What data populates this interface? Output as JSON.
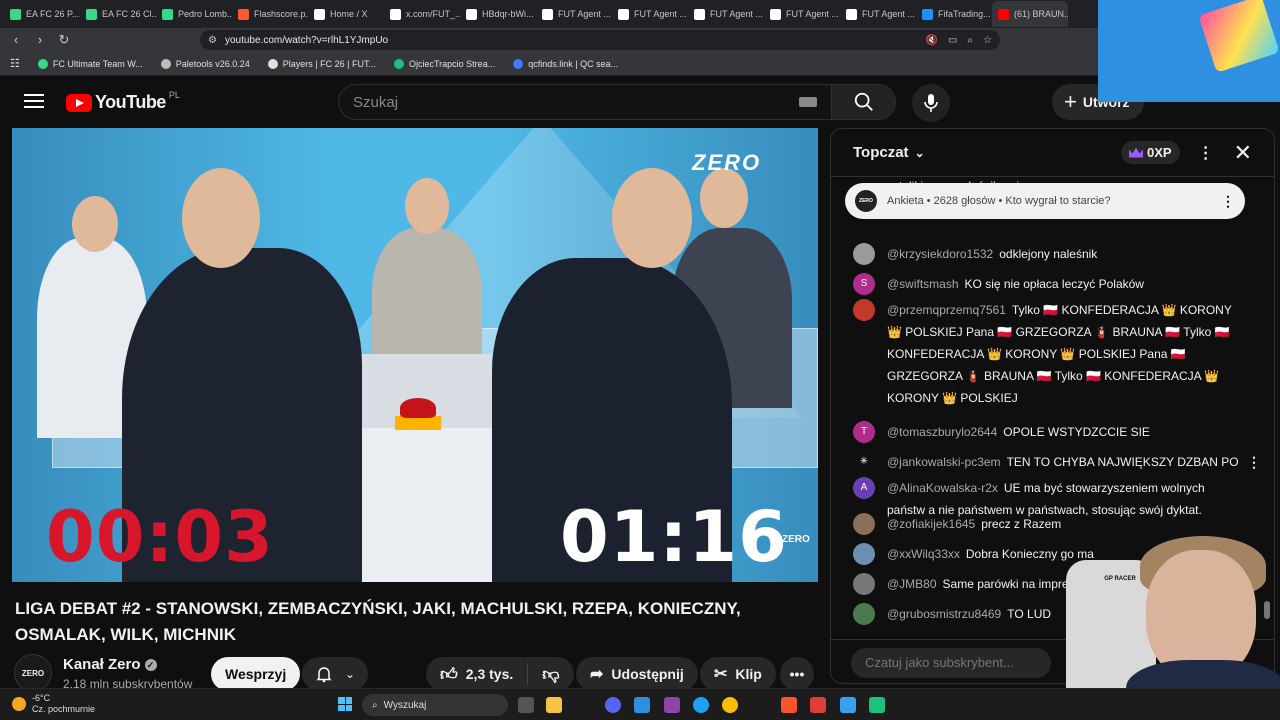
{
  "browser": {
    "tabs": [
      {
        "label": "EA FC 26 P...",
        "icon_color": "#39d98a"
      },
      {
        "label": "EA FC 26 Cl...",
        "icon_color": "#39d98a"
      },
      {
        "label": "Pedro Lomb...",
        "icon_color": "#39d98a"
      },
      {
        "label": "Flashscore.p...",
        "icon_color": "#ff5a28"
      },
      {
        "label": "Home / X",
        "icon_color": "#ffffff"
      },
      {
        "label": "x.com/FUT_...",
        "icon_color": "#ffffff"
      },
      {
        "label": "HBdqr-bWi...",
        "icon_color": "#ffffff"
      },
      {
        "label": "FUT Agent ...",
        "icon_color": "#ffffff"
      },
      {
        "label": "FUT Agent ...",
        "icon_color": "#ffffff"
      },
      {
        "label": "FUT Agent ...",
        "icon_color": "#ffffff"
      },
      {
        "label": "FUT Agent ...",
        "icon_color": "#ffffff"
      },
      {
        "label": "FUT Agent ...",
        "icon_color": "#ffffff"
      },
      {
        "label": "FifaTrading...",
        "icon_color": "#1e90ff"
      },
      {
        "label": "(61) BRAUN...",
        "icon_color": "#ff0000"
      }
    ],
    "url": "youtube.com/watch?v=rlhL1YJmpUo",
    "bookmarks": [
      {
        "label": "FC Ultimate Team W...",
        "color": "#39d98a"
      },
      {
        "label": "Paletools v26.0.24",
        "color": "#bbbbbb"
      },
      {
        "label": "Players | FC 26 | FUT...",
        "color": "#e0e0e0"
      },
      {
        "label": "OjciecTrapcio Strea...",
        "color": "#19c37d"
      },
      {
        "label": "qcfinds.link | QC sea...",
        "color": "#3d7bfd"
      }
    ]
  },
  "header": {
    "logo_text": "YouTube",
    "country": "PL",
    "search_placeholder": "Szukaj",
    "create_label": "Utwórz"
  },
  "video": {
    "brand": "ZERO",
    "brand_small": "ZERO",
    "timer_left": "00:03",
    "timer_right": "01:16",
    "title": "LIGA DEBAT #2 - STANOWSKI, ZEMBACZYŃSKI, JAKI, MACHULSKI, RZEPA, KONIECZNY, OSMALAK, WILK, MICHNIK"
  },
  "channel": {
    "avatar_text": "ZERO",
    "name": "Kanał Zero",
    "subscribers": "2,18 mln subskrybentów",
    "support_label": "Wesprzyj"
  },
  "actions": {
    "likes": "2,3 tys.",
    "share_label": "Udostępnij",
    "clip_label": "Klip"
  },
  "chat": {
    "mode": "Topczat",
    "xp": "0XP",
    "poll_avatar": "ZERO",
    "poll_text": "Ankieta • 2628 głosów • Kto wygrał to starcie?",
    "input_placeholder": "Czatuj jako subskrybent...",
    "messages": [
      {
        "author": "",
        "text": "stolikiem w naleśnikarni",
        "avatar": "",
        "avatar_color": "#0f0f0f"
      },
      {
        "author": "@krzysiekdoro1532",
        "text": "odklejony naleśnik",
        "avatar": "",
        "avatar_color": "#9a9a9a"
      },
      {
        "author": "@swiftsmash",
        "text": "KO się nie opłaca leczyć Polaków",
        "avatar": "S",
        "avatar_color": "#b02d8c"
      },
      {
        "author": "@przemqprzemq7561",
        "text": "Tylko 🇵🇱 KONFEDERACJA 👑 KORONY 👑 POLSKIEJ Pana 🇵🇱 GRZEGORZA 🧯 BRAUNA 🇵🇱 Tylko 🇵🇱 KONFEDERACJA 👑 KORONY 👑 POLSKIEJ Pana 🇵🇱 GRZEGORZA 🧯 BRAUNA 🇵🇱 Tylko 🇵🇱 KONFEDERACJA 👑 KORONY 👑 POLSKIEJ",
        "avatar": "",
        "avatar_color": "#c0392b"
      },
      {
        "author": "@tomaszburylo2644",
        "text": "OPOLE WSTYDZCCIE SIE",
        "avatar": "T",
        "avatar_color": "#b02d8c"
      },
      {
        "author": "@jankowalski-pc3em",
        "text": "TEN TO CHYBA NAJWIĘKSZY DZBAN PO",
        "avatar": "✳",
        "avatar_color": "#0f0f0f"
      },
      {
        "author": "@AlinaKowalska-r2x",
        "text": "UE ma być stowarzyszeniem wolnych państw a nie państwem w państwach, stosując swój dyktat.",
        "avatar": "A",
        "avatar_color": "#6a3fb5"
      },
      {
        "author": "@zofiakijek1645",
        "text": "precz z Razem",
        "avatar": "",
        "avatar_color": "#8a6e55"
      },
      {
        "author": "@xxWilq33xx",
        "text": "Dobra Konieczny go ma",
        "avatar": "",
        "avatar_color": "#6c8fb0"
      },
      {
        "author": "@JMB80",
        "text": "Same parówki na imprezi",
        "avatar": "",
        "avatar_color": "#777777"
      },
      {
        "author": "@grubosmistrzu8469",
        "text": "TO LUD",
        "avatar": "",
        "avatar_color": "#4c7a4c"
      }
    ]
  },
  "taskbar": {
    "temperature": "-6°C",
    "weather": "Cz. pochmurnie",
    "search_label": "Wyszukaj"
  },
  "webcam": {
    "chair_brand": "GP RACER"
  }
}
